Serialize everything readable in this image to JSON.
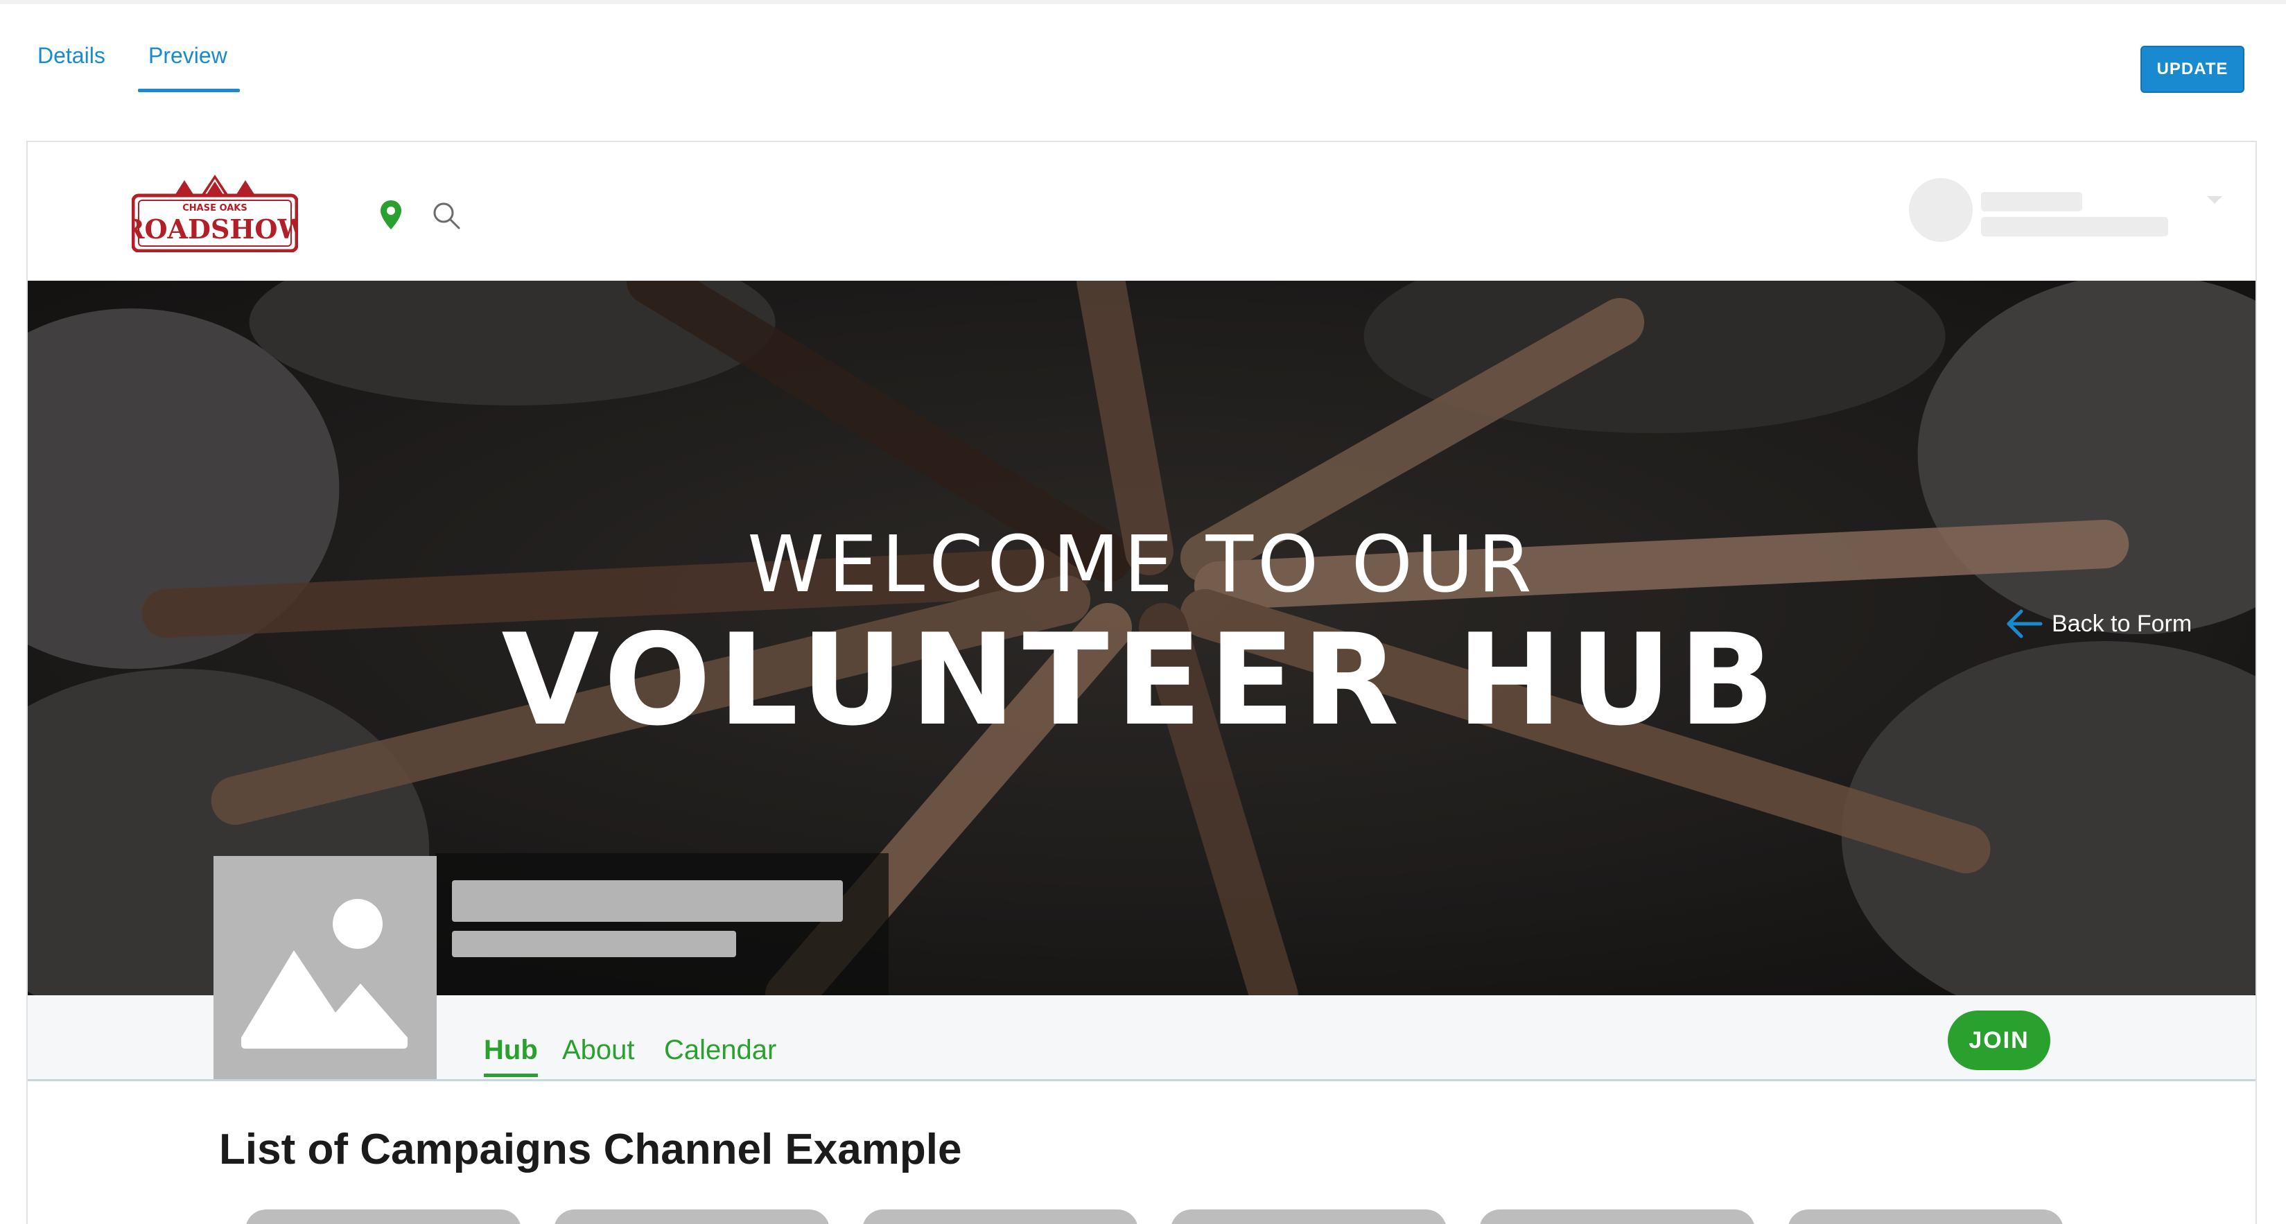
{
  "tabs": {
    "details_label": "Details",
    "preview_label": "Preview",
    "active": "Preview"
  },
  "toolbar": {
    "update_label": "UPDATE"
  },
  "site": {
    "logo": {
      "top_text": "CHASE OAKS",
      "main_text": "ROADSHOW"
    },
    "icons": [
      "location-pin-icon",
      "search-icon"
    ]
  },
  "hero": {
    "welcome_line": "WELCOME TO OUR",
    "title_line": "VOLUNTEER HUB",
    "back_link_label": "Back to Form"
  },
  "nav": {
    "items": [
      {
        "label": "Hub",
        "active": true
      },
      {
        "label": "About",
        "active": false
      },
      {
        "label": "Calendar",
        "active": false
      }
    ],
    "join_label": "JOIN"
  },
  "content": {
    "section_title": "List of Campaigns Channel Example"
  },
  "colors": {
    "accent_blue": "#1a8ad0",
    "brand_green": "#2aa12e",
    "logo_red": "#b21f27"
  }
}
